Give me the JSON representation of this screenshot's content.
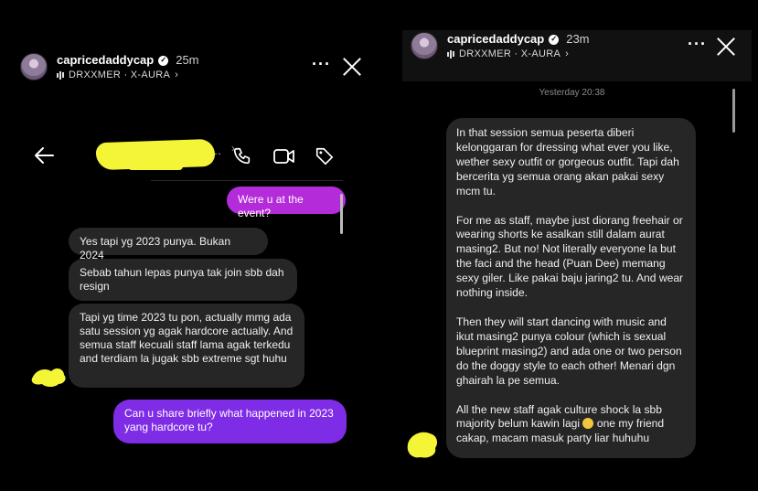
{
  "left": {
    "story": {
      "username": "capricedaddycap",
      "time": "25m",
      "music": "DRXXMER · X-AURA"
    },
    "messages": [
      {
        "dir": "out",
        "text": "Were u at the event?"
      },
      {
        "dir": "in",
        "text": "Yes tapi yg 2023 punya. Bukan 2024"
      },
      {
        "dir": "in",
        "text": "Sebab tahun lepas punya tak join sbb dah resign"
      },
      {
        "dir": "in",
        "text": "Tapi yg time 2023 tu pon, actually mmg ada satu session yg agak hardcore actually. And semua staff kecuali staff lama agak terkedu and terdiam la jugak sbb extreme sgt huhu"
      },
      {
        "dir": "out",
        "text": "Can u share briefly what happened in 2023 yang hardcore tu?"
      }
    ]
  },
  "right": {
    "story": {
      "username": "capricedaddycap",
      "time": "23m",
      "music": "DRXXMER · X-AURA"
    },
    "date_separator": "Yesterday 20:38",
    "message": {
      "p1": "In that session semua peserta diberi kelonggaran for dressing what ever you like, wether sexy outfit or gorgeous outfit. Tapi dah bercerita yg semua orang akan pakai sexy mcm tu.",
      "p2": "For me as staff, maybe just diorang freehair or wearing shorts ke asalkan still dalam aurat masing2. But no! Not literally everyone la but the faci and the head (Puan Dee) memang sexy giler. Like pakai baju jaring2 tu. And wear nothing inside.",
      "p3": "Then they will start dancing with music and ikut masing2 punya colour (which is sexual blueprint masing2) and ada one or two person do the doggy style to each other! Menari dgn ghairah la pe semua.",
      "p4a": "All the new staff agak culture shock la sbb majority belum kawin lagi",
      "p4b": "one my friend cakap, macam masuk party liar huhuhu"
    }
  },
  "colors": {
    "bg": "#000000",
    "incoming": "#262626",
    "outgoing_magenta": "#b42bd9",
    "outgoing_purple": "#7f2ce6",
    "redaction": "#f4f536"
  }
}
